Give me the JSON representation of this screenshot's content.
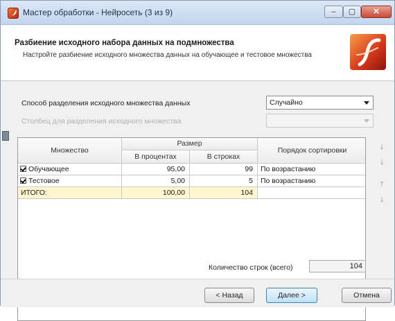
{
  "window": {
    "title": "Мастер обработки - Нейросеть (3 из 9)",
    "controls": {
      "minimize": "–",
      "maximize": "▢",
      "close": "✕"
    }
  },
  "header": {
    "title": "Разбиение исходного набора данных на подмножества",
    "description": "Настройте разбиение исходного множества данных на обучающее и тестовое множества"
  },
  "split_method": {
    "label": "Способ разделения исходного множества данных",
    "value": "Случайно"
  },
  "split_column": {
    "label": "Столбец для разделения исходного множества",
    "value": ""
  },
  "table": {
    "headers": {
      "set": "Множество",
      "size": "Размер",
      "percent": "В процентах",
      "rows": "В строках",
      "sort_order": "Порядок сортировки"
    },
    "rows": [
      {
        "name": "Обучающее",
        "checked": true,
        "percent": "95,00",
        "rows": "99",
        "sort": "По возрастанию"
      },
      {
        "name": "Тестовое",
        "checked": true,
        "percent": "5,00",
        "rows": "5",
        "sort": "По возрастанию"
      }
    ],
    "total": {
      "name": "ИТОГО:",
      "percent": "100,00",
      "rows": "104",
      "sort": ""
    }
  },
  "side_toolbar": {
    "sort_asc_icon": "↓",
    "sort_desc_icon": "↓",
    "move_up_icon": "↑",
    "move_down_icon": "↓"
  },
  "row_count": {
    "label": "Количество строк (всего)",
    "value": "104"
  },
  "buttons": {
    "back": "< Назад",
    "next": "Далее >",
    "cancel": "Отмена"
  }
}
